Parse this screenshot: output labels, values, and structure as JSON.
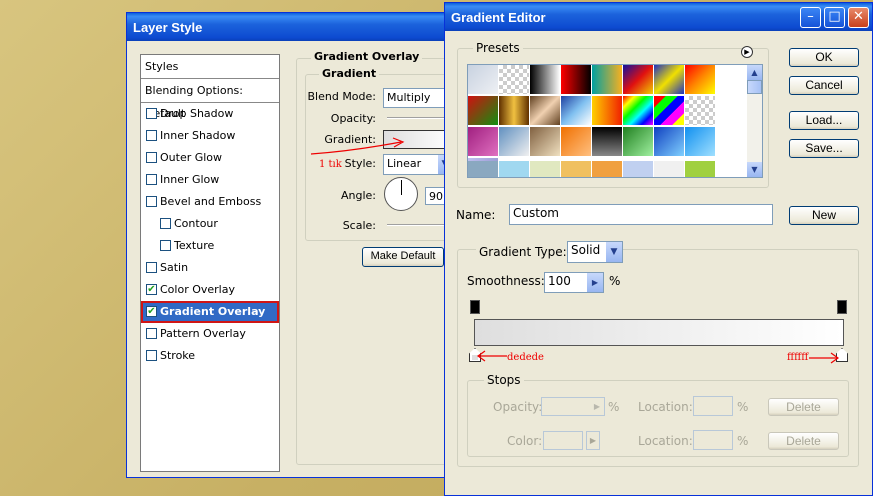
{
  "layer_style": {
    "title": "Layer Style",
    "styles_header": "Styles",
    "blending_options": "Blending Options: Default",
    "items": [
      {
        "label": "Drop Shadow",
        "checked": false,
        "indent": false
      },
      {
        "label": "Inner Shadow",
        "checked": false,
        "indent": false
      },
      {
        "label": "Outer Glow",
        "checked": false,
        "indent": false
      },
      {
        "label": "Inner Glow",
        "checked": false,
        "indent": false
      },
      {
        "label": "Bevel and Emboss",
        "checked": false,
        "indent": false
      },
      {
        "label": "Contour",
        "checked": false,
        "indent": true
      },
      {
        "label": "Texture",
        "checked": false,
        "indent": true
      },
      {
        "label": "Satin",
        "checked": false,
        "indent": false
      },
      {
        "label": "Color Overlay",
        "checked": true,
        "indent": false
      },
      {
        "label": "Gradient Overlay",
        "checked": true,
        "indent": false
      },
      {
        "label": "Pattern Overlay",
        "checked": false,
        "indent": false
      },
      {
        "label": "Stroke",
        "checked": false,
        "indent": false
      }
    ],
    "section_title": "Gradient Overlay",
    "group_title": "Gradient",
    "blend_mode_label": "Blend Mode:",
    "blend_mode_value": "Multiply",
    "opacity_label": "Opacity:",
    "gradient_label": "Gradient:",
    "style_label": "Style:",
    "style_value": "Linear",
    "angle_label": "Angle:",
    "angle_value": "90",
    "scale_label": "Scale:",
    "make_default": "Make Default",
    "annotation": "1 tık"
  },
  "gradient_editor": {
    "title": "Gradient Editor",
    "presets_label": "Presets",
    "ok": "OK",
    "cancel": "Cancel",
    "load": "Load...",
    "save": "Save...",
    "name_label": "Name:",
    "name_value": "Custom",
    "new_button": "New",
    "gradient_type_label": "Gradient Type:",
    "gradient_type_value": "Solid",
    "smoothness_label": "Smoothness:",
    "smoothness_value": "100",
    "percent": "%",
    "stop_left_annotation": "dedede",
    "stop_right_annotation": "ffffff",
    "stops_label": "Stops",
    "opacity_label": "Opacity:",
    "location_label": "Location:",
    "color_label": "Color:",
    "delete_label": "Delete",
    "colors": {
      "start": "#dedede",
      "end": "#ffffff"
    }
  }
}
